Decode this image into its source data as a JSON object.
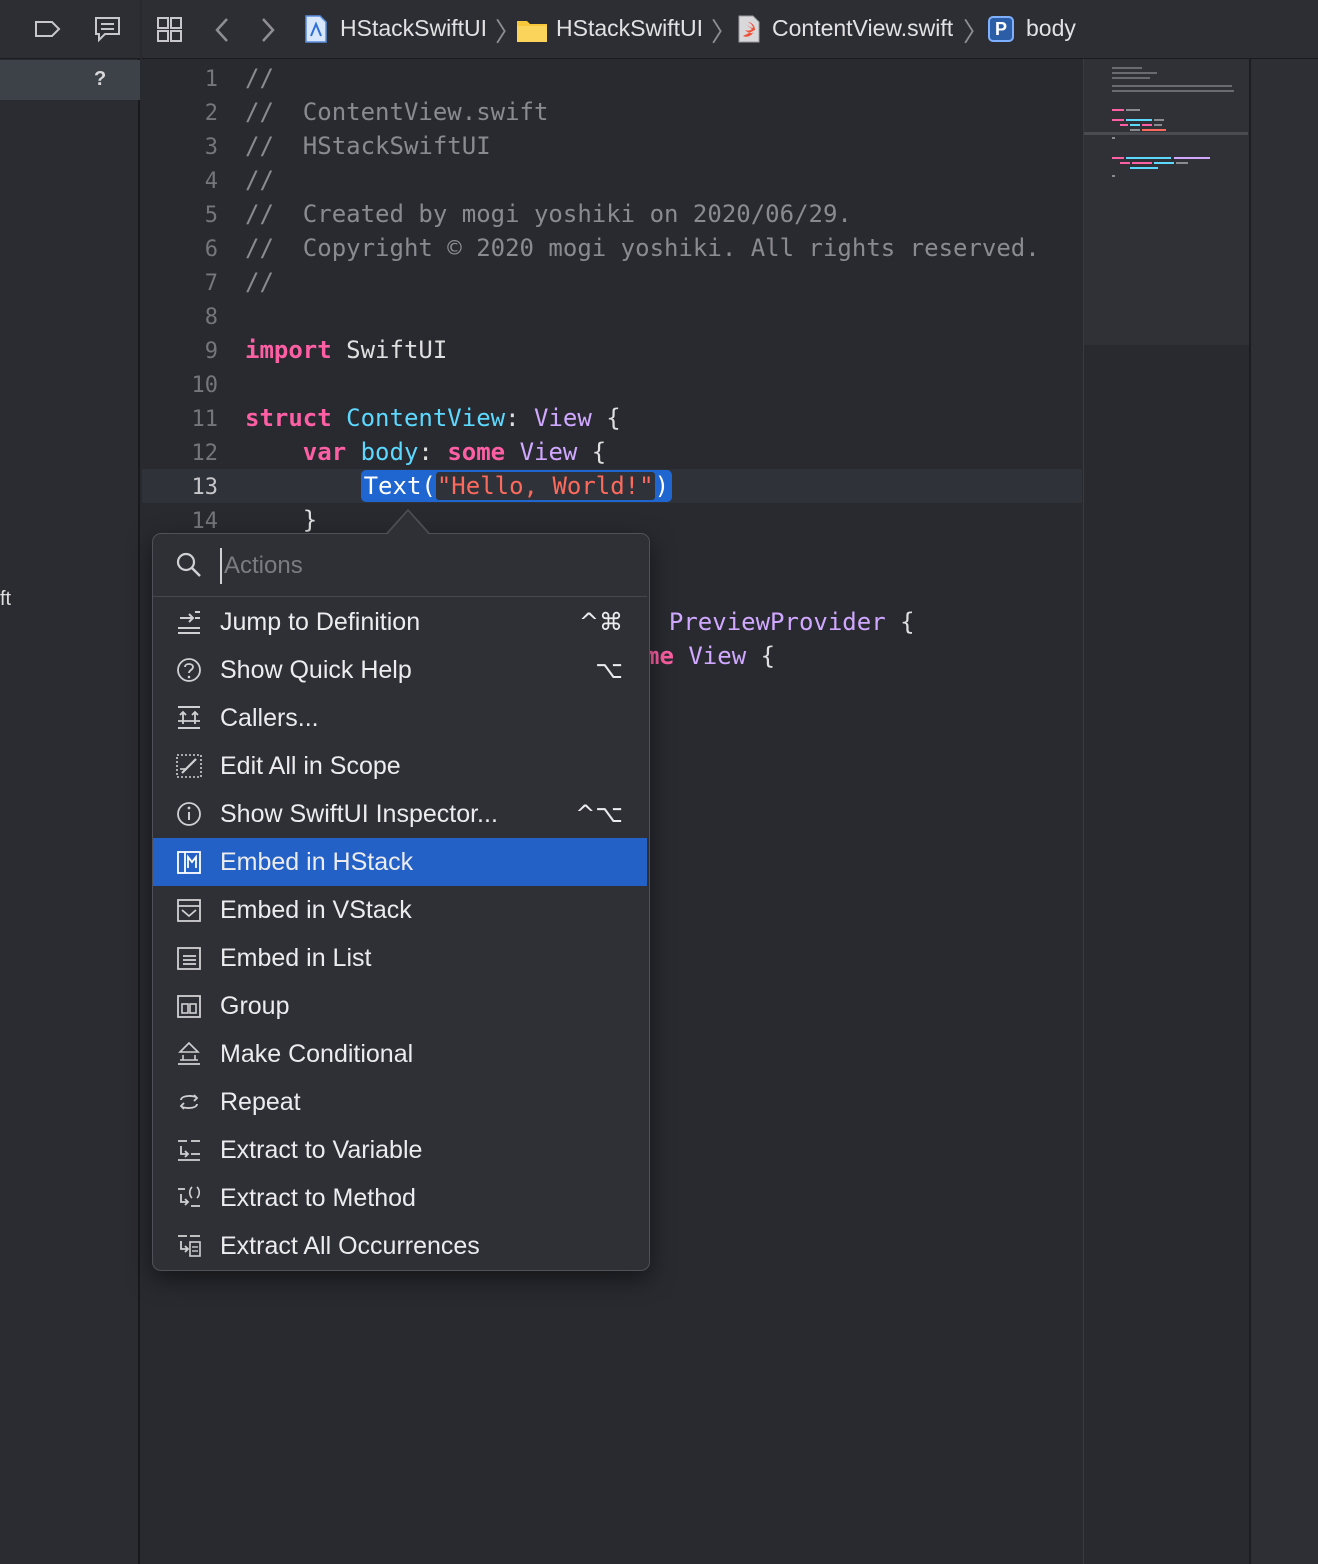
{
  "breadcrumb": {
    "project": "HStackSwiftUI",
    "folder": "HStackSwiftUI",
    "file": "ContentView.swift",
    "symbol": "body",
    "symbol_badge": "P"
  },
  "navigator": {
    "help_mark": "?",
    "partial_label": "ft"
  },
  "editor": {
    "line_numbers": [
      "1",
      "2",
      "3",
      "4",
      "5",
      "6",
      "7",
      "8",
      "9",
      "10",
      "11",
      "12",
      "13",
      "14"
    ],
    "comment_lines": [
      "//",
      "//  ContentView.swift",
      "//  HStackSwiftUI",
      "//",
      "//  Created by mogi yoshiki on 2020/06/29.",
      "//  Copyright © 2020 mogi yoshiki. All rights reserved.",
      "//"
    ],
    "line9": {
      "kw": "import",
      "rest": " SwiftUI"
    },
    "line11": {
      "kw": "struct",
      "name": "ContentView",
      "colon": ": ",
      "type": "View",
      "brace": " {"
    },
    "line12": {
      "kw": "var",
      "name": "body",
      "colon": ": ",
      "kw2": "some",
      "type": "View",
      "brace": " {"
    },
    "line13": {
      "call": "Text(",
      "string": "\"Hello, World!\"",
      "close": ")"
    },
    "line14": "}",
    "partial_line17": {
      "colon": ": ",
      "type": "PreviewProvider",
      "brace": " {"
    },
    "partial_line18": {
      "kw": "me",
      "type": "View",
      "brace": " {"
    }
  },
  "actions_popover": {
    "search_placeholder": "Actions",
    "items": [
      {
        "label": "Jump to Definition",
        "shortcut": "^⌘",
        "icon": "jump-icon"
      },
      {
        "label": "Show Quick Help",
        "shortcut": "⌥",
        "icon": "question-circle-icon"
      },
      {
        "label": "Callers...",
        "shortcut": "",
        "icon": "callers-icon"
      },
      {
        "label": "Edit All in Scope",
        "shortcut": "",
        "icon": "edit-scope-icon"
      },
      {
        "label": "Show SwiftUI Inspector...",
        "shortcut": "^⌥",
        "icon": "info-circle-icon"
      },
      {
        "label": "Embed in HStack",
        "shortcut": "",
        "icon": "hstack-icon",
        "selected": true
      },
      {
        "label": "Embed in VStack",
        "shortcut": "",
        "icon": "vstack-icon"
      },
      {
        "label": "Embed in List",
        "shortcut": "",
        "icon": "list-icon"
      },
      {
        "label": "Group",
        "shortcut": "",
        "icon": "group-icon"
      },
      {
        "label": "Make Conditional",
        "shortcut": "",
        "icon": "conditional-icon"
      },
      {
        "label": "Repeat",
        "shortcut": "",
        "icon": "repeat-icon"
      },
      {
        "label": "Extract to Variable",
        "shortcut": "",
        "icon": "extract-variable-icon"
      },
      {
        "label": "Extract to Method",
        "shortcut": "",
        "icon": "extract-method-icon"
      },
      {
        "label": "Extract All Occurrences",
        "shortcut": "",
        "icon": "extract-all-icon"
      }
    ]
  },
  "colors": {
    "background": "#292a30",
    "keyword": "#fc5fa3",
    "type": "#5dd8ff",
    "string": "#fc6a5d",
    "comment": "#8a8b91",
    "selection": "#2461c6"
  }
}
